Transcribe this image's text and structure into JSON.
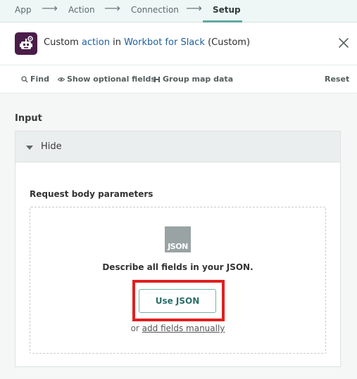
{
  "stepper": {
    "steps": [
      "App",
      "Connection",
      "Setup"
    ],
    "step_app": "App",
    "step_action": "Action",
    "step_connection": "Connection",
    "step_setup": "Setup",
    "arrow": "⟶"
  },
  "header": {
    "prefix": "Custom ",
    "action_link": "action",
    "mid": " in ",
    "app_link": "Workbot for Slack",
    "suffix": " (Custom)",
    "app_icon": "workbot-robot-icon",
    "close_icon": "close-icon"
  },
  "toolbar": {
    "find": "Find",
    "optional": "Show optional fields",
    "group": "Group map data",
    "reset": "Reset"
  },
  "input": {
    "section_label": "Input",
    "toggle_label": "Hide",
    "request_label": "Request body parameters",
    "json_icon_text": "JSON",
    "describe_text": "Describe all fields in your JSON.",
    "use_json_label": "Use JSON",
    "or_text": "or ",
    "add_fields_link": "add fields manually"
  },
  "colors": {
    "accent": "#2b6e69",
    "highlight": "#e02020",
    "app_icon_bg": "#4a1d49"
  }
}
